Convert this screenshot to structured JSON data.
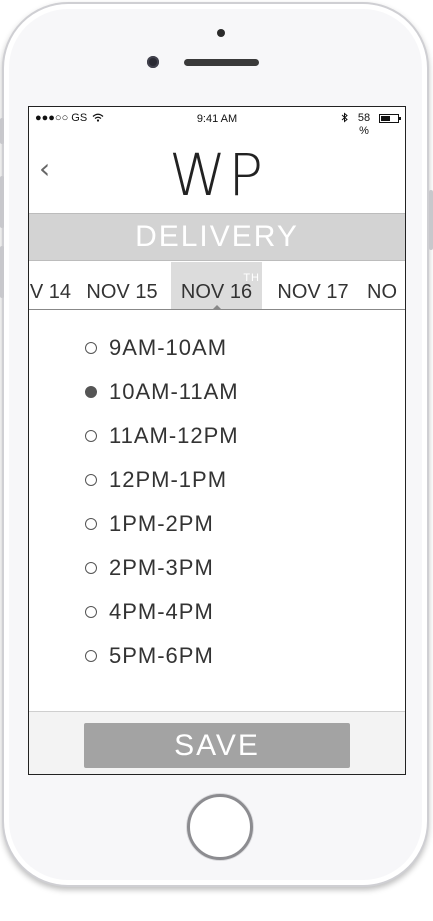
{
  "status_bar": {
    "signal": "●●●○○ GS",
    "wifi_icon": "wifi-icon",
    "time": "9:41 AM",
    "bluetooth_icon": "bluetooth-icon",
    "battery_percent": "58 %",
    "battery_level": 0.58
  },
  "header": {
    "back_icon": "chevron-left-icon",
    "back_glyph": "‹",
    "logo": "WP"
  },
  "title": "DELIVERY",
  "dates": [
    {
      "label": "V 14"
    },
    {
      "label": "NOV 15"
    },
    {
      "label": "NOV 16",
      "suffix": "TH",
      "selected": true
    },
    {
      "label": "NOV 17"
    },
    {
      "label": "NO"
    }
  ],
  "slots": [
    {
      "label": "9AM-10AM",
      "checked": false
    },
    {
      "label": "10AM-11AM",
      "checked": true
    },
    {
      "label": "11AM-12PM",
      "checked": false
    },
    {
      "label": "12PM-1PM",
      "checked": false
    },
    {
      "label": "1PM-2PM",
      "checked": false
    },
    {
      "label": "2PM-3PM",
      "checked": false
    },
    {
      "label": "4PM-4PM",
      "checked": false
    },
    {
      "label": "5PM-6PM",
      "checked": false
    }
  ],
  "save_label": "SAVE",
  "colors": {
    "title_bar": "#d3d3d3",
    "save_button": "#a3a3a3",
    "selected_date": "#dcdcdc"
  }
}
